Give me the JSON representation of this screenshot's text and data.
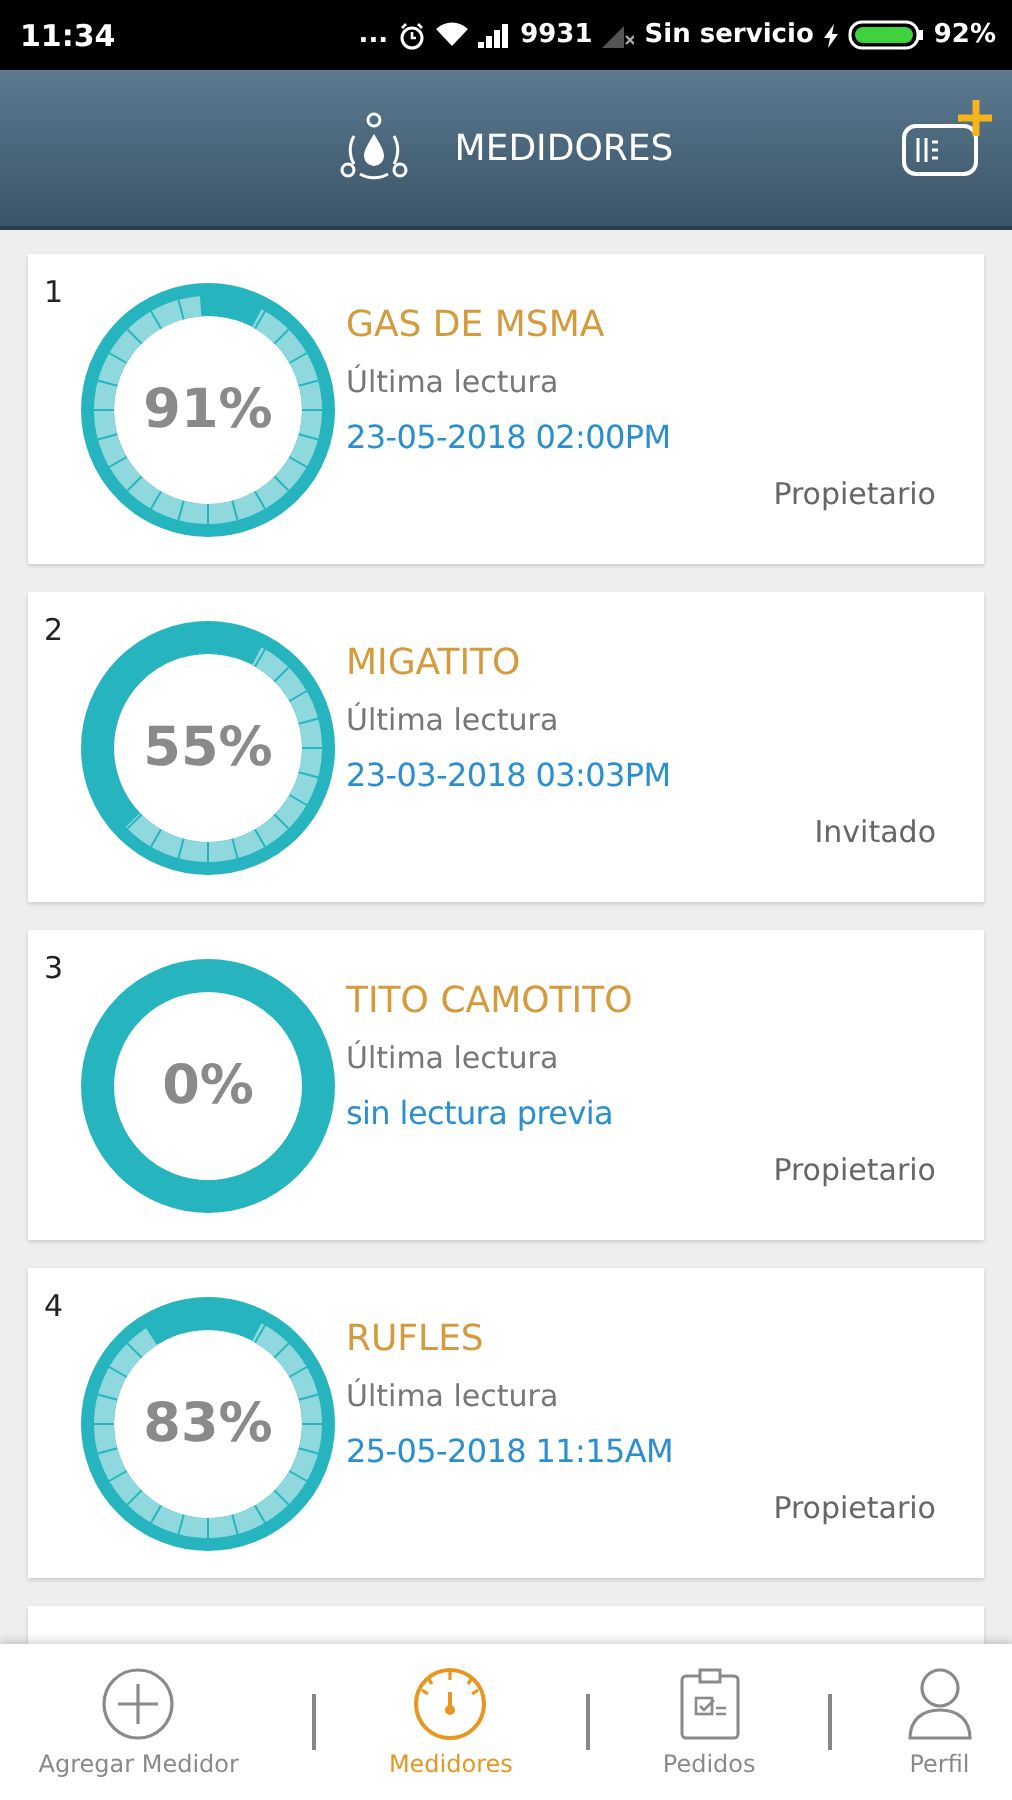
{
  "status_bar": {
    "time": "11:34",
    "more": "...",
    "data_rate": "9931",
    "carrier": "Sin servicio",
    "battery": "92%"
  },
  "header": {
    "title": "MEDIDORES"
  },
  "meters": [
    {
      "number": "1",
      "name": "GAS DE MSMA",
      "label": "Última lectura",
      "reading": "23-05-2018 02:00PM",
      "percent": "91%",
      "level": 0.91,
      "role": "Propietario"
    },
    {
      "number": "2",
      "name": "MIGATITO",
      "label": "Última lectura",
      "reading": "23-03-2018 03:03PM",
      "percent": "55%",
      "level": 0.55,
      "role": "Invitado"
    },
    {
      "number": "3",
      "name": "TITO CAMOTITO",
      "label": "Última lectura",
      "reading": "sin lectura previa",
      "percent": "0%",
      "level": 0,
      "role": "Propietario"
    },
    {
      "number": "4",
      "name": "RUFLES",
      "label": "Última lectura",
      "reading": "25-05-2018 11:15AM",
      "percent": "83%",
      "level": 0.83,
      "role": "Propietario"
    }
  ],
  "nav": [
    {
      "kind": "add",
      "label": "Agregar Medidor",
      "selected": false
    },
    {
      "kind": "gauge",
      "label": "Medidores",
      "selected": true
    },
    {
      "kind": "clipboard",
      "label": "Pedidos",
      "selected": false
    },
    {
      "kind": "person",
      "label": "Perfil",
      "selected": false
    }
  ]
}
